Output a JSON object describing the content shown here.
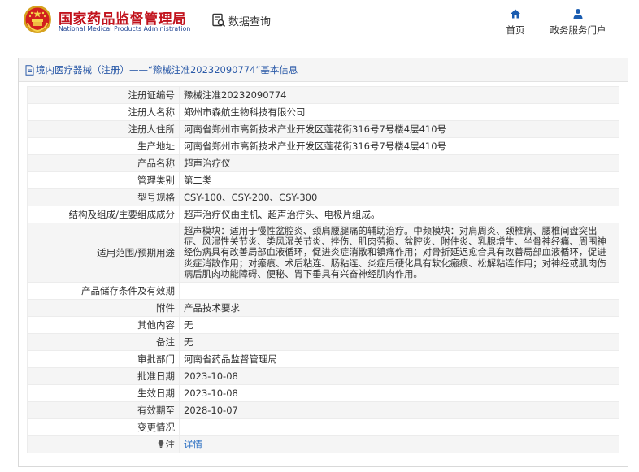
{
  "header": {
    "site_title": "国家药品监督管理局",
    "site_subtitle": "National Medical Products Administration",
    "data_query": "数据查询",
    "nav": {
      "home": "首页",
      "portal": "政务服务门户"
    }
  },
  "panel": {
    "title": "境内医疗器械（注册）——“豫械注准20232090774”基本信息"
  },
  "rows": [
    {
      "key": "注册证编号",
      "value": "豫械注准20232090774"
    },
    {
      "key": "注册人名称",
      "value": "郑州市森航生物科技有限公司"
    },
    {
      "key": "注册人住所",
      "value": "河南省郑州市高新技术产业开发区莲花街316号7号楼4层410号"
    },
    {
      "key": "生产地址",
      "value": "河南省郑州市高新技术产业开发区莲花街316号7号楼4层410号"
    },
    {
      "key": "产品名称",
      "value": "超声治疗仪"
    },
    {
      "key": "管理类别",
      "value": "第二类"
    },
    {
      "key": "型号规格",
      "value": "CSY-100、CSY-200、CSY-300"
    },
    {
      "key": "结构及组成/主要组成成分",
      "value": "超声治疗仪由主机、超声治疗头、电极片组成。"
    },
    {
      "key": "适用范围/预期用途",
      "value": "超声模块：适用于慢性盆腔炎、颈肩腰腿痛的辅助治疗。中频模块：对肩周炎、颈椎病、腰椎间盘突出症、风湿性关节炎、类风湿关节炎、挫伤、肌肉劳损、盆腔炎、附件炎、乳腺增生、坐骨神经痛、周围神经伤病具有改善局部血液循环，促进炎症消散和镇痛作用；对骨折延迟愈合具有改善局部血液循环，促进炎症消散作用；对瘢痕、术后粘连、肠粘连、炎症后硬化具有软化瘢痕、松解粘连作用；对神经或肌肉伤病后肌肉功能障碍、便秘、胃下垂具有兴奋神经肌肉作用。"
    },
    {
      "key": "产品储存条件及有效期",
      "value": ""
    },
    {
      "key": "附件",
      "value": "产品技术要求"
    },
    {
      "key": "其他内容",
      "value": "无"
    },
    {
      "key": "备注",
      "value": "无"
    },
    {
      "key": "审批部门",
      "value": "河南省药品监督管理局"
    },
    {
      "key": "批准日期",
      "value": "2023-10-08"
    },
    {
      "key": "生效日期",
      "value": "2023-10-08"
    },
    {
      "key": "有效期至",
      "value": "2028-10-07"
    },
    {
      "key": "变更情况",
      "value": ""
    }
  ],
  "note_row": {
    "key": "注",
    "link": "详情"
  },
  "colors": {
    "brand_red": "#c1121c",
    "link_blue": "#2b6fc2",
    "nav_blue": "#1a5cb0"
  }
}
